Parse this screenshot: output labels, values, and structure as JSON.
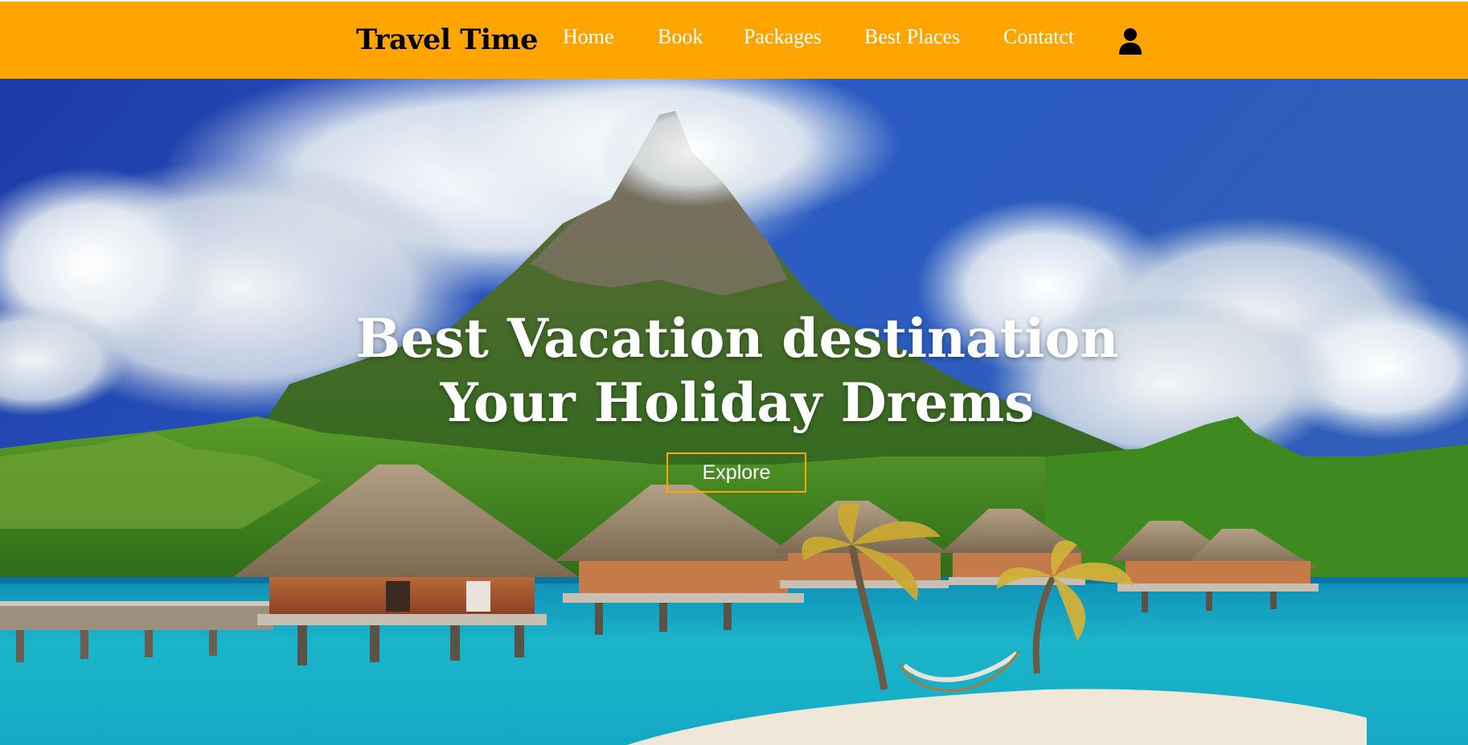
{
  "header": {
    "brand": "Travel Time",
    "nav": [
      {
        "label": "Home"
      },
      {
        "label": "Book"
      },
      {
        "label": "Packages"
      },
      {
        "label": "Best Places"
      },
      {
        "label": "Contatct"
      }
    ],
    "user_icon": "user-icon"
  },
  "hero": {
    "line1": "Best Vacation destination",
    "line2": "Your Holiday Drems",
    "button_label": "Explore",
    "background": "tropical-island-bungalows-photo"
  },
  "colors": {
    "accent": "#ffa502",
    "text_light": "#ffffff",
    "brand_text": "#000000"
  }
}
